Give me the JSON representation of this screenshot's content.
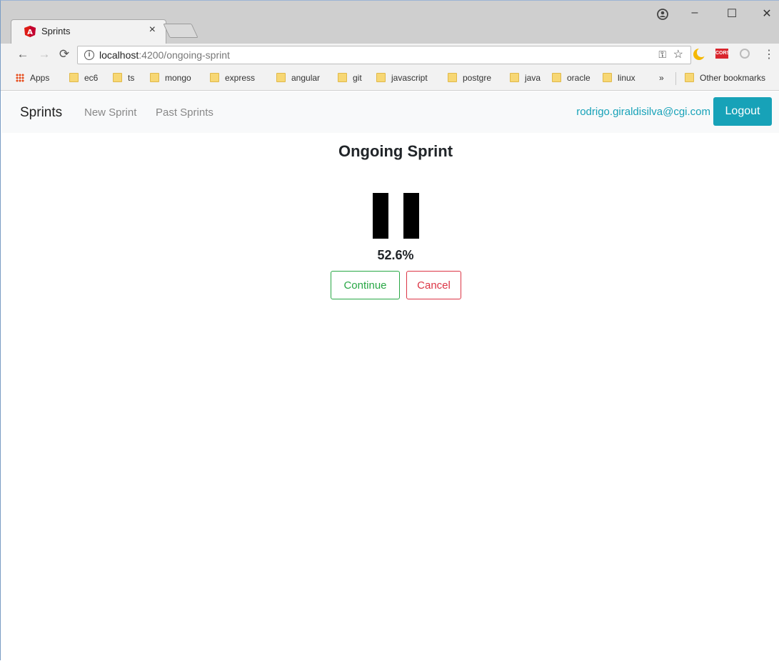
{
  "browser": {
    "tab_title": "Sprints",
    "tab_close": "×",
    "url_host": "localhost",
    "url_rest": ":4200/ongoing-sprint",
    "window_controls": {
      "minimize": "–",
      "maximize": "☐",
      "close": "✕"
    }
  },
  "bookmarks": {
    "apps_label": "Apps",
    "items": [
      "ec6",
      "ts",
      "mongo",
      "express",
      "angular",
      "git",
      "javascript",
      "postgre",
      "java",
      "oracle",
      "linux"
    ],
    "overflow": "»",
    "other": "Other bookmarks"
  },
  "extensions": {
    "cors_label": "CORS"
  },
  "navbar": {
    "brand": "Sprints",
    "links": {
      "new_sprint": "New Sprint",
      "past_sprints": "Past Sprints"
    },
    "user_email": "rodrigo.giraldisilva@cgi.com",
    "logout_label": "Logout"
  },
  "main": {
    "title": "Ongoing Sprint",
    "progress_text": "52.6%",
    "progress_value": 0.526,
    "continue_label": "Continue",
    "cancel_label": "Cancel"
  },
  "colors": {
    "accent": "#17a2b8",
    "success": "#28a745",
    "danger": "#dc3545"
  }
}
